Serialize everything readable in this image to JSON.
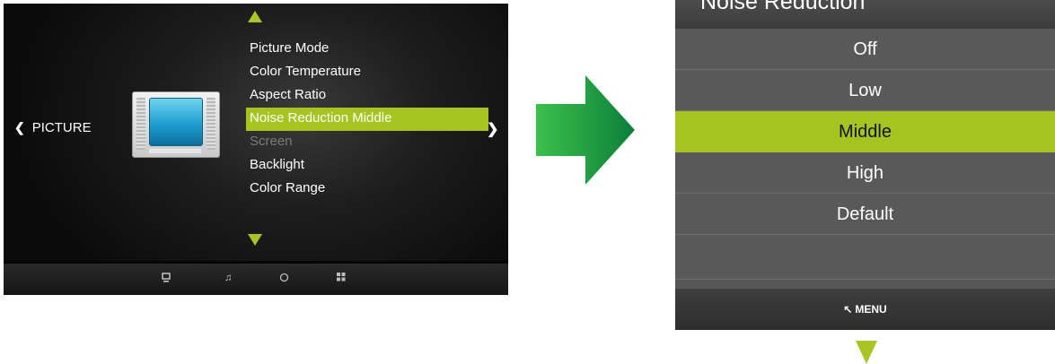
{
  "colors": {
    "accent": "#a6c41f",
    "arrow_green": "#1fa84a"
  },
  "osd": {
    "category": {
      "chevron_icon": "chevron-left-icon",
      "label": "PICTURE"
    },
    "menu_items": [
      {
        "label": "Picture Mode",
        "state": "normal"
      },
      {
        "label": "Color Temperature",
        "state": "normal"
      },
      {
        "label": "Aspect Ratio",
        "state": "normal"
      },
      {
        "label": "Noise Reduction Middle",
        "state": "selected"
      },
      {
        "label": "Screen",
        "state": "disabled"
      },
      {
        "label": "Backlight",
        "state": "normal"
      },
      {
        "label": "Color Range",
        "state": "normal"
      }
    ],
    "bottom_icons": [
      "monitor-icon",
      "music-note-icon",
      "clock-icon",
      "grid-icon"
    ]
  },
  "panel": {
    "title": "Noise Reduction",
    "options": [
      {
        "label": "Off",
        "state": "normal"
      },
      {
        "label": "Low",
        "state": "normal"
      },
      {
        "label": "Middle",
        "state": "selected"
      },
      {
        "label": "High",
        "state": "normal"
      },
      {
        "label": "Default",
        "state": "normal"
      }
    ],
    "footer_label": "MENU"
  }
}
